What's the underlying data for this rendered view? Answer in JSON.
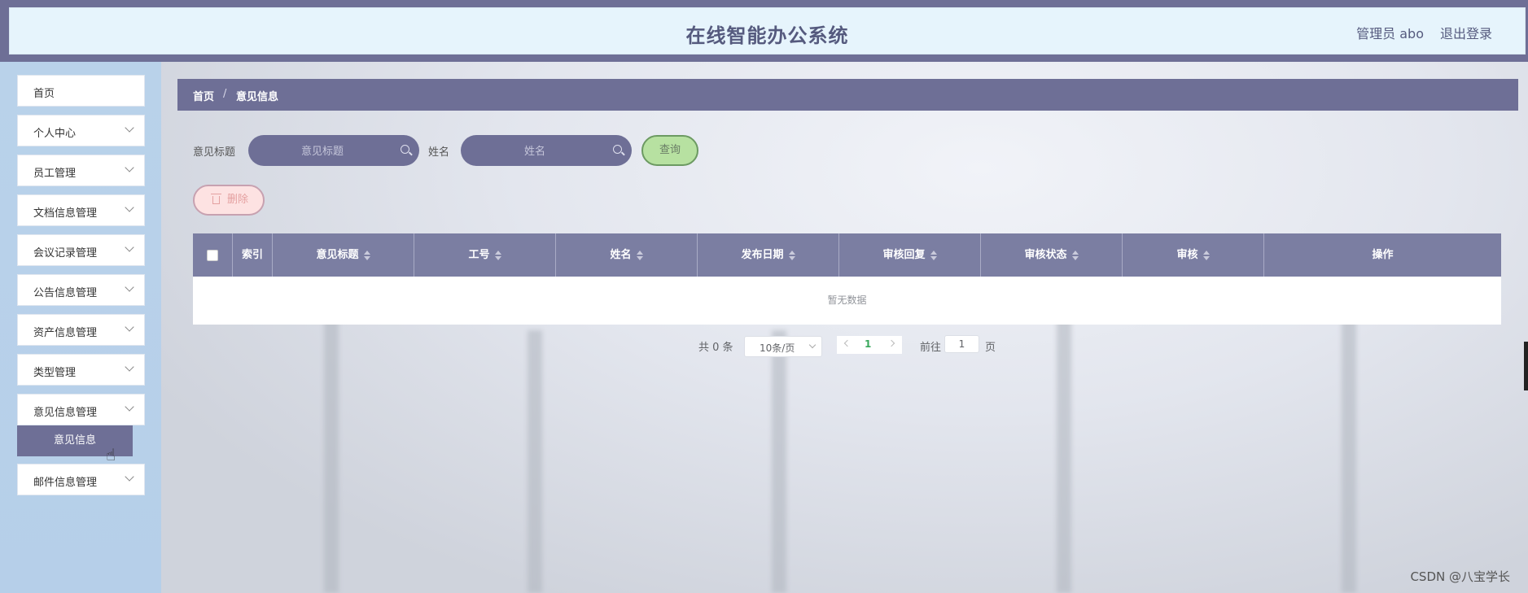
{
  "header": {
    "title": "在线智能办公系统",
    "user": "管理员 abo",
    "logout": "退出登录"
  },
  "sidebar": {
    "items": [
      {
        "label": "首页"
      },
      {
        "label": "个人中心"
      },
      {
        "label": "员工管理"
      },
      {
        "label": "文档信息管理"
      },
      {
        "label": "会议记录管理"
      },
      {
        "label": "公告信息管理"
      },
      {
        "label": "资产信息管理"
      },
      {
        "label": "类型管理"
      },
      {
        "label": "意见信息管理"
      },
      {
        "label": "邮件信息管理"
      }
    ],
    "active_sub": "意见信息"
  },
  "breadcrumb": {
    "home": "首页",
    "separator": "/",
    "current": "意见信息"
  },
  "search": {
    "title_label": "意见标题",
    "title_placeholder": "意见标题",
    "name_label": "姓名",
    "name_placeholder": "姓名",
    "query_button": "查询"
  },
  "actions": {
    "delete": "删除"
  },
  "table": {
    "columns": [
      "",
      "索引",
      "意见标题",
      "工号",
      "姓名",
      "发布日期",
      "审核回复",
      "审核状态",
      "审核",
      "操作"
    ],
    "empty_text": "暂无数据"
  },
  "pagination": {
    "total": "共 0 条",
    "page_size": "10条/页",
    "current_page": "1",
    "goto_label": "前往",
    "goto_value": "1",
    "page_suffix": "页"
  },
  "watermark": "CSDN @八宝学长",
  "colors": {
    "primary": "#6e6f96",
    "header_bg": "#e6f4fc",
    "sidebar_bg": "#b9d2ea",
    "query_bg": "#b7e1a1",
    "delete_bg": "#fde2e2"
  }
}
